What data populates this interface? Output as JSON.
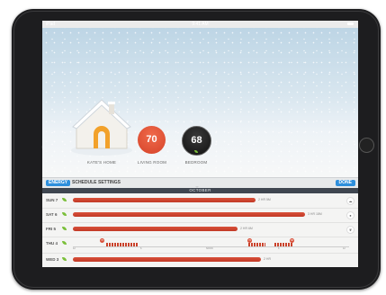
{
  "status": {
    "carrier": "iPad",
    "time": "9:41 AM"
  },
  "devices": [
    {
      "label": "KATE'S HOME"
    },
    {
      "label": "LIVING ROOM",
      "temp": "70",
      "color": "#d9472c"
    },
    {
      "label": "BEDROOM",
      "temp": "68",
      "color": "#1a1a1a"
    }
  ],
  "toolbar": {
    "energy": "ENERGY",
    "schedule": "SCHEDULE",
    "settings": "SETTINGS",
    "done": "DONE"
  },
  "month": "OCTOBER",
  "days": [
    {
      "day": "SUN",
      "date": "7",
      "value": 0.7,
      "label": "2 HR 5M",
      "icon": "cloud-icon"
    },
    {
      "day": "SAT",
      "date": "6",
      "value": 0.89,
      "label": "3 HR 18M",
      "icon": "person-icon"
    },
    {
      "day": "FRI",
      "date": "5",
      "value": 0.63,
      "label": "2 HR 6M",
      "icon": "leaf-icon"
    },
    {
      "day": "THU",
      "date": "4",
      "expanded": true
    },
    {
      "day": "WED",
      "date": "3",
      "value": 0.72,
      "label": "2 HR",
      "icon": ""
    }
  ],
  "timeline": {
    "pins": [
      "70",
      "70",
      "68"
    ],
    "labels": [
      "12",
      "6",
      "NOON",
      "6",
      "12"
    ]
  }
}
